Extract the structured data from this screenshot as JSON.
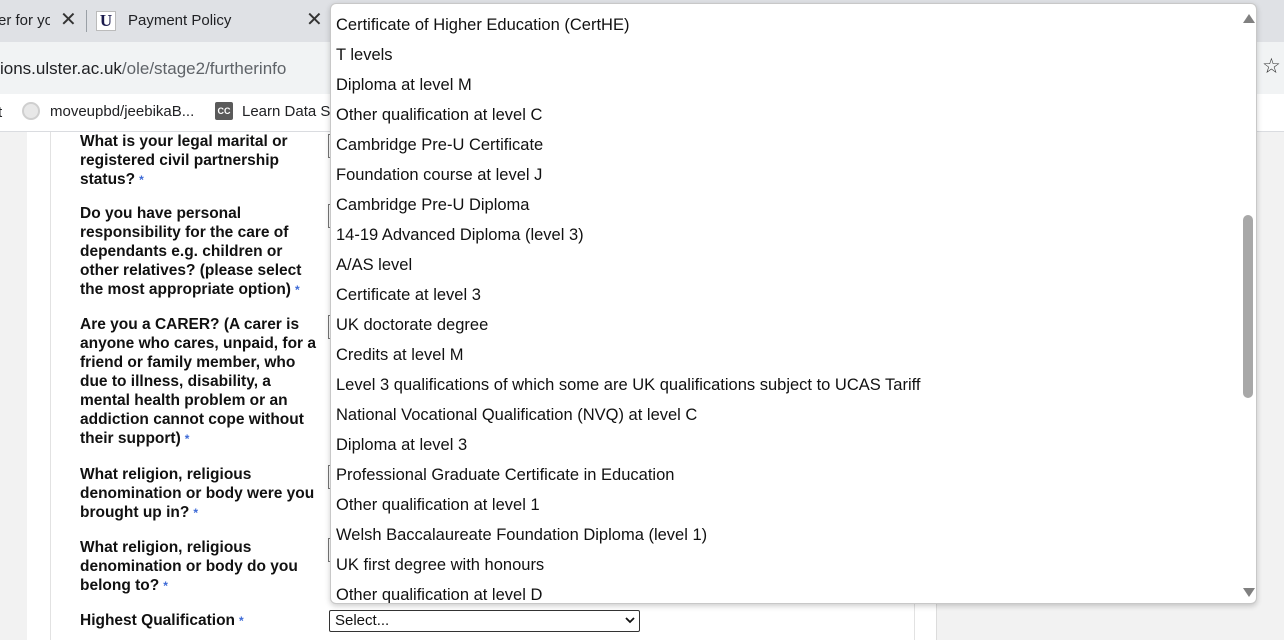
{
  "browser": {
    "tabs": [
      {
        "title": "er for yo",
        "close": "✕"
      },
      {
        "title": "Payment Policy",
        "favicon": "U",
        "close": "✕"
      }
    ],
    "url": {
      "host": "ions.ulster.ac.uk",
      "path": "/ole/stage2/furtherinfo"
    },
    "bookmarks": [
      {
        "label": "t",
        "icon": ""
      },
      {
        "label": "moveupbd/jeebikaB...",
        "icon": "github-icon"
      },
      {
        "label": "Learn Data St",
        "icon": "datacamp-icon",
        "icon_text": "CC"
      }
    ]
  },
  "form": {
    "required_marker": "*",
    "questions": [
      {
        "label": "What is your legal marital or registered civil partnership status?"
      },
      {
        "label": "Do you have personal responsibility for the care of dependants e.g. children or other relatives? (please select the most appropriate option)"
      },
      {
        "label": "Are you a CARER? (A carer is anyone who cares, unpaid, for a friend or family member, who due to illness, disability, a mental health problem or an addiction cannot cope without their support)"
      },
      {
        "label": "What religion, religious denomination or body were you brought up in?"
      },
      {
        "label": "What religion, religious denomination or body do you belong to?"
      },
      {
        "label": "Highest Qualification"
      }
    ],
    "highest_qualification": {
      "selected": "Select..."
    }
  },
  "dropdown": {
    "options": [
      "Certificate of Higher Education (CertHE)",
      "T levels",
      "Diploma at level M",
      "Other qualification at level C",
      "Cambridge Pre-U Certificate",
      "Foundation course at level J",
      "Cambridge Pre-U Diploma",
      "14-19 Advanced Diploma (level 3)",
      "A/AS level",
      "Certificate at level 3",
      "UK doctorate degree",
      "Credits at level M",
      "Level 3 qualifications of which some are UK qualifications subject to UCAS Tariff",
      "National Vocational Qualification (NVQ) at level C",
      "Diploma at level 3",
      "Professional Graduate Certificate in Education",
      "Other qualification at level 1",
      "Welsh Baccalaureate Foundation Diploma (level 1)",
      "UK first degree with honours",
      "Other qualification at level D"
    ],
    "scroll_position": 0.35
  }
}
